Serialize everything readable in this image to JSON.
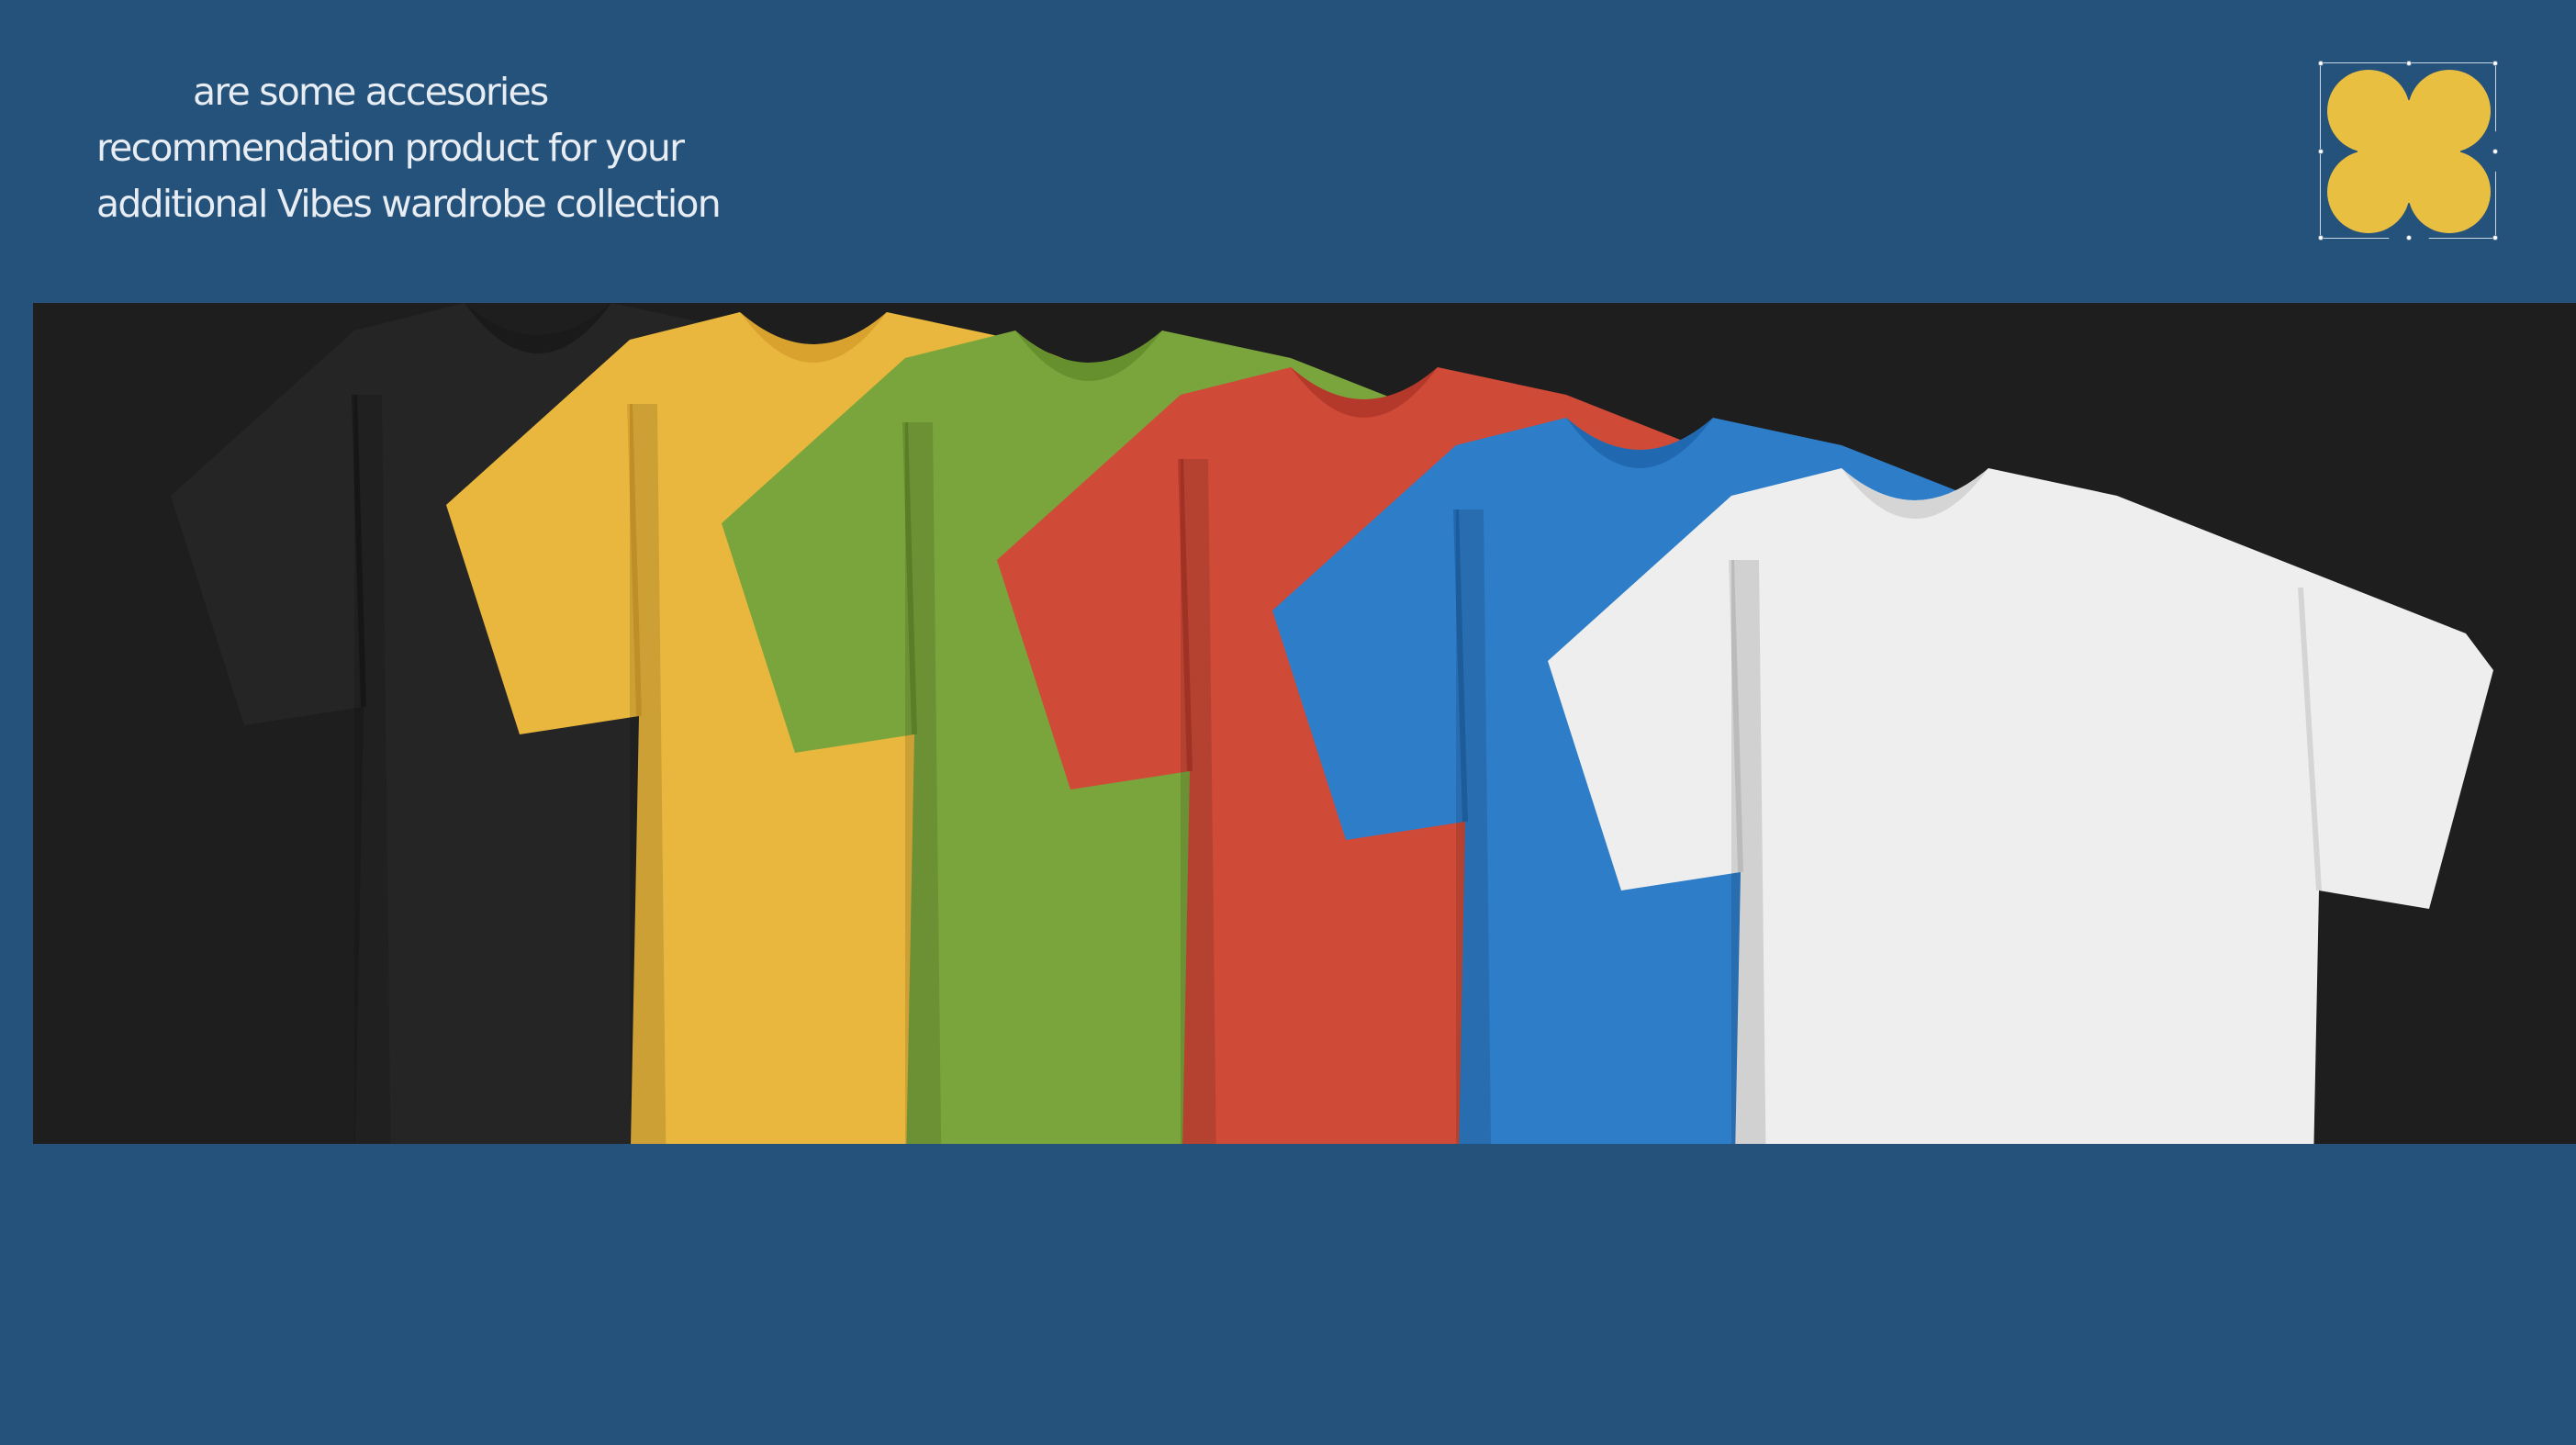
{
  "intro": {
    "lines": [
      "are some accesories",
      "recommendation product for your",
      "additional Vibes wardrobe collection"
    ]
  },
  "logo": {
    "icon": "clover-x-icon",
    "color": "#e9bf41",
    "selected": true
  },
  "banner": {
    "background": "#1e1e1e",
    "shirts": [
      {
        "name": "black",
        "color": "#252525",
        "shade": "#1a1a1a"
      },
      {
        "name": "yellow",
        "color": "#eab73e",
        "shade": "#d9a22e"
      },
      {
        "name": "green",
        "color": "#7aa53c",
        "shade": "#66902d"
      },
      {
        "name": "red",
        "color": "#cf4a37",
        "shade": "#b5392a"
      },
      {
        "name": "blue",
        "color": "#2d7dc8",
        "shade": "#2069b0"
      },
      {
        "name": "white",
        "color": "#eeeeee",
        "shade": "#d5d5d5"
      }
    ]
  },
  "colors": {
    "page_background": "#25527b",
    "text": "#e8edf3",
    "accent": "#e9bf41"
  }
}
